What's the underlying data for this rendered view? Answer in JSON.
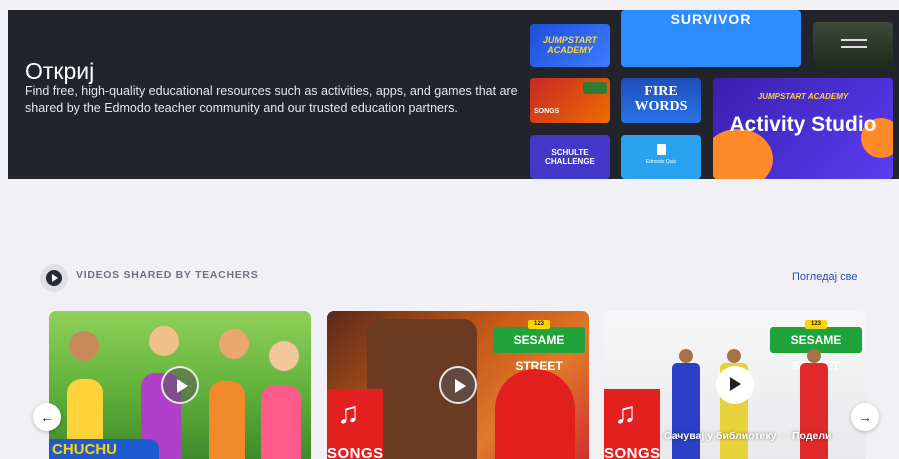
{
  "hero": {
    "title": "Откриј",
    "description": "Find free, high-quality educational resources such as activities, apps, and games that are shared by the Edmodo teacher community and our trusted education partners.",
    "tiles": {
      "jumpstart": "JUMPSTART ACADEMY",
      "survivor": "SURVIVOR",
      "songs": "SONGS",
      "firewords": "FIRE WORDS",
      "activity_small": "JUMPSTART ACADEMY",
      "activity_big": "Activity Studio",
      "schulte": "SCHULTE CHALLENGE",
      "quiz": "Edmodo Quiz"
    }
  },
  "section": {
    "title": "VIDEOS SHARED BY TEACHERS",
    "view_all": "Погледај све"
  },
  "cards": [
    {
      "brand": "CHUCHU"
    },
    {
      "brand": "SESAME STREET",
      "brand_num": "123",
      "songs": "SONGS"
    },
    {
      "brand": "SESAME STREET",
      "brand_num": "123",
      "songs": "SONGS",
      "save": "Сачувај у библиотеку",
      "sep": "·",
      "share": "Подели"
    }
  ],
  "nav": {
    "prev": "←",
    "next": "→"
  },
  "colors": {
    "hero_bg": "#22242c",
    "link": "#2a4fa8",
    "page_bg": "#f1f1f5"
  }
}
